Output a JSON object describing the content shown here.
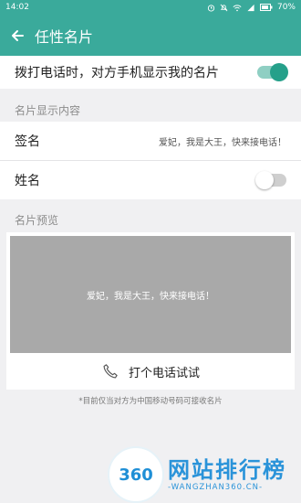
{
  "status_bar": {
    "time": "14:02",
    "battery": "70%"
  },
  "header": {
    "title": "任性名片"
  },
  "show_card_row": {
    "label": "拨打电话时，对方手机显示我的名片",
    "enabled": true
  },
  "content_section": {
    "header": "名片显示内容",
    "signature": {
      "label": "签名",
      "value": "爱妃，我是大王，快来接电话！"
    },
    "name": {
      "label": "姓名",
      "enabled": false
    }
  },
  "preview_section": {
    "header": "名片预览",
    "preview_text": "爱妃，我是大王，快来接电话！",
    "call_test_label": "打个电话试试"
  },
  "footnote": "*目前仅当对方为中国移动号码可接收名片",
  "watermark": {
    "number": "360",
    "title": "网站排行榜",
    "url": "-WANGZHAN360.CN-"
  },
  "colors": {
    "accent": "#3aaa9b",
    "toggle_on": "#25a08a",
    "preview_bg": "#a9a9a9"
  }
}
